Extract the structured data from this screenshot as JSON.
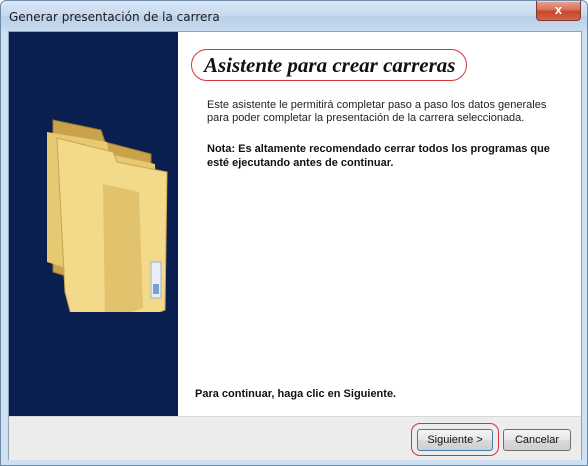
{
  "window": {
    "title": "Generar presentación de la carrera",
    "close_label": "x"
  },
  "content": {
    "heading": "Asistente para crear carreras",
    "intro": "Este asistente le permitirá completar paso a paso los datos generales para poder completar la presentación de la carrera seleccionada.",
    "note": "Nota: Es altamente recomendado cerrar todos los programas que esté ejecutando antes de continuar.",
    "continue_hint": "Para continuar, haga clic en Siguiente."
  },
  "buttons": {
    "next_label": "Siguiente >",
    "cancel_label": "Cancelar"
  },
  "colors": {
    "side_panel": "#0a1f4f",
    "highlight_ring": "#d7333a",
    "folder": "#f3d98a"
  },
  "icons": {
    "folder": "folder-icon"
  }
}
